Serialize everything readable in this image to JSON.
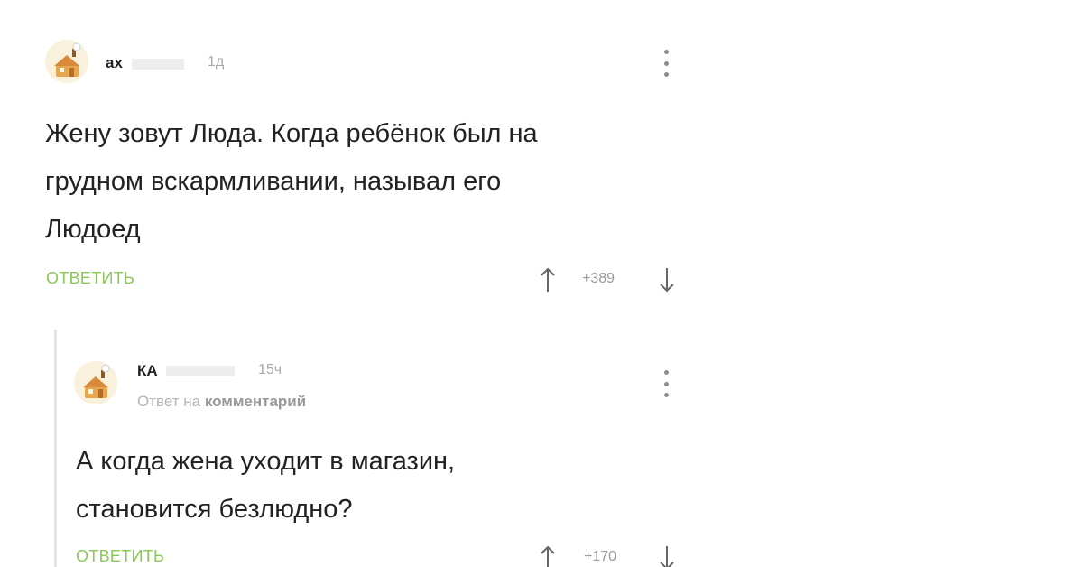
{
  "comments": [
    {
      "username": "ах",
      "time": "1д",
      "text_lines": [
        "Жену зовут Люда. Когда ребёнок был на",
        "грудном вскармливании, называл его",
        "Людоед"
      ],
      "reply_label": "ОТВЕТИТЬ",
      "rating": "+389"
    },
    {
      "username": "КА",
      "time": "15ч",
      "reply_note_prefix": "Ответ на",
      "reply_note_target": "комментарий",
      "text_lines": [
        "А когда жена уходит в магазин,",
        "становится безлюдно?"
      ],
      "reply_label": "ОТВЕТИТЬ",
      "rating": "+170"
    }
  ],
  "colors": {
    "answer_link": "#8ac858",
    "meta_gray": "#aaaaaa",
    "text": "#222222"
  },
  "icons": [
    "avatar-icon",
    "more-menu-icon",
    "arrow-up-icon",
    "arrow-down-icon"
  ]
}
